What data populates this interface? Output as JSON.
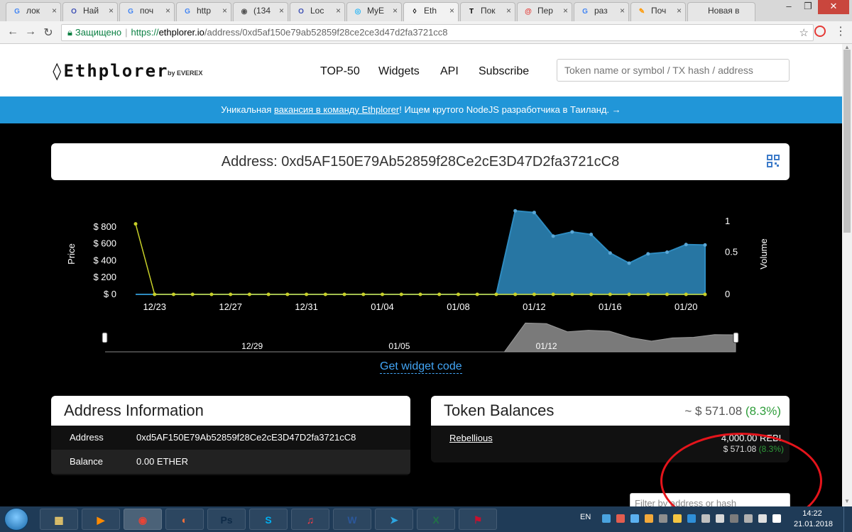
{
  "browser": {
    "tabs": [
      {
        "label": "лок",
        "icon_color": "#4285f4",
        "icon": "G"
      },
      {
        "label": "Най",
        "icon_color": "#3f51b5",
        "icon": "O"
      },
      {
        "label": "поч",
        "icon_color": "#4285f4",
        "icon": "G"
      },
      {
        "label": "http",
        "icon_color": "#4285f4",
        "icon": "G"
      },
      {
        "label": "(134",
        "icon_color": "#555555",
        "icon": "◉"
      },
      {
        "label": "Loc",
        "icon_color": "#3f51b5",
        "icon": "O"
      },
      {
        "label": "MyE",
        "icon_color": "#29b6f6",
        "icon": "◎"
      },
      {
        "label": "Eth",
        "icon_color": "#000000",
        "icon": "◊"
      },
      {
        "label": "Пок",
        "icon_color": "#000000",
        "icon": "T"
      },
      {
        "label": "Пер",
        "icon_color": "#e53935",
        "icon": "@"
      },
      {
        "label": "раз",
        "icon_color": "#4285f4",
        "icon": "G"
      },
      {
        "label": "Поч",
        "icon_color": "#ff9800",
        "icon": "✎"
      },
      {
        "label": "Новая в",
        "icon_color": "",
        "icon": ""
      }
    ],
    "active_tab_index": 7,
    "url_secure_label": "Защищено",
    "url_scheme": "https://",
    "url_host": "ethplorer.io",
    "url_path": "/address/0xd5af150e79ab52859f28ce2ce3d47d2fa3721cc8"
  },
  "site": {
    "logo": "◊Ethplorer",
    "logo_by": "by EVEREX",
    "nav": [
      "TOP-50",
      "Widgets",
      "API",
      "Subscribe"
    ],
    "search_placeholder": "Token name or symbol / TX hash / address",
    "banner_pre": "Уникальная ",
    "banner_link": "вакансия в команду Ethplorer",
    "banner_post": "! Ищем крутого NodeJS разработчика в Таиланд. →"
  },
  "address_card": {
    "title": "Address: 0xd5AF150E79Ab52859f28Ce2cE3D47D2fa3721cC8"
  },
  "chart_data": {
    "type": "area",
    "ylabel_left": "Price",
    "ylabel_right": "Volume",
    "left_ticks": [
      "$ 800",
      "$ 600",
      "$ 400",
      "$ 200",
      "$ 0"
    ],
    "left_tick_values": [
      800,
      600,
      400,
      200,
      0
    ],
    "right_ticks": [
      "1",
      "0.5",
      "0"
    ],
    "right_tick_values": [
      1,
      0.5,
      0
    ],
    "xlabels": [
      "12/23",
      "12/27",
      "12/31",
      "01/04",
      "01/08",
      "01/12",
      "01/16",
      "01/20"
    ],
    "x_dates": [
      "12/22",
      "12/23",
      "12/24",
      "12/25",
      "12/26",
      "12/27",
      "12/28",
      "12/29",
      "12/30",
      "12/31",
      "01/01",
      "01/02",
      "01/03",
      "01/04",
      "01/05",
      "01/06",
      "01/07",
      "01/08",
      "01/09",
      "01/10",
      "01/11",
      "01/12",
      "01/13",
      "01/14",
      "01/15",
      "01/16",
      "01/17",
      "01/18",
      "01/19",
      "01/20",
      "01/21"
    ],
    "price": [
      0,
      0,
      0,
      0,
      0,
      0,
      0,
      0,
      0,
      0,
      0,
      0,
      0,
      0,
      0,
      0,
      0,
      0,
      0,
      0,
      990,
      970,
      690,
      740,
      710,
      490,
      370,
      480,
      500,
      590,
      585
    ],
    "volume": [
      1,
      0,
      0,
      0,
      0,
      0,
      0,
      0,
      0,
      0,
      0,
      0,
      0,
      0,
      0,
      0,
      0,
      0,
      0,
      0,
      0,
      0,
      0,
      0,
      0,
      0,
      0,
      0,
      0,
      0,
      0
    ],
    "price_color": "#2e8bc0",
    "volume_color": "#c7cf28",
    "navigator_labels": [
      "12/29",
      "01/05",
      "01/12"
    ],
    "widget_link": "Get widget code"
  },
  "address_info": {
    "title": "Address Information",
    "rows": [
      {
        "key": "Address",
        "value": "0xd5AF150E79Ab52859f28Ce2cE3D47D2fa3721cC8"
      },
      {
        "key": "Balance",
        "value": "0.00 ETHER"
      }
    ]
  },
  "token_balances": {
    "title": "Token Balances",
    "total_prefix": "~ $ 571.08 ",
    "total_change": "(8.3%)",
    "tokens": [
      {
        "name": "Rebellious",
        "quantity": "4,000.00 REBL",
        "value": "$ 571.08 ",
        "change": "(8.3%)"
      }
    ]
  },
  "filter_placeholder": "Filter by address or hash",
  "taskbar": {
    "lang": "EN",
    "time": "14:22",
    "date": "21.01.2018",
    "apps": [
      {
        "name": "explorer",
        "glyph": "▦",
        "color": "#e8c76a"
      },
      {
        "name": "media",
        "glyph": "▶",
        "color": "#ff8a00"
      },
      {
        "name": "chrome",
        "glyph": "◉",
        "color": "#ea4335"
      },
      {
        "name": "firefox",
        "glyph": "◐",
        "color": "#ff7139"
      },
      {
        "name": "photoshop",
        "glyph": "Ps",
        "color": "#0e2a47"
      },
      {
        "name": "skype",
        "glyph": "S",
        "color": "#00aff0"
      },
      {
        "name": "itunes",
        "glyph": "♫",
        "color": "#fc3c44"
      },
      {
        "name": "word",
        "glyph": "W",
        "color": "#2b579a"
      },
      {
        "name": "telegram",
        "glyph": "➤",
        "color": "#2ca5e0"
      },
      {
        "name": "excel",
        "glyph": "X",
        "color": "#217346"
      },
      {
        "name": "acrobat",
        "glyph": "⚑",
        "color": "#c8102e"
      }
    ]
  }
}
